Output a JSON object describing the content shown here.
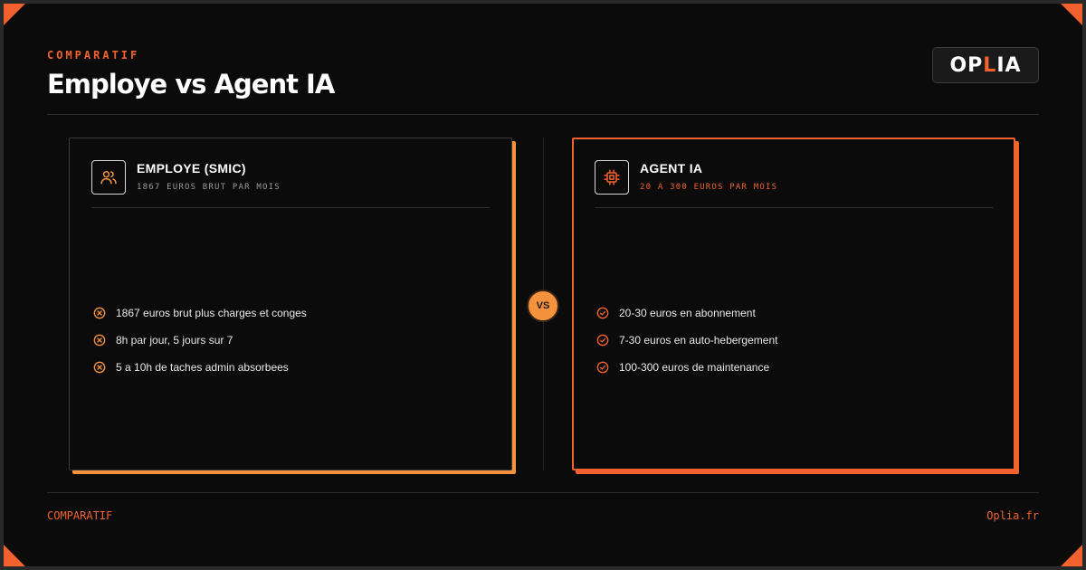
{
  "header": {
    "eyebrow": "COMPARATIF",
    "title": "Employe vs Agent IA"
  },
  "logo": {
    "prefix": "OP",
    "accent": "L",
    "suffix": "IA"
  },
  "vs_label": "VS",
  "cards": {
    "left": {
      "icon": "users-icon",
      "title": "EMPLOYE (SMIC)",
      "subtitle": "1867 EUROS BRUT PAR MOIS",
      "bullet_icon": "x-circle-icon",
      "items": [
        "1867 euros brut plus charges et conges",
        "8h par jour, 5 jours sur 7",
        "5 a 10h de taches admin absorbees"
      ]
    },
    "right": {
      "icon": "cpu-chip-icon",
      "title": "AGENT IA",
      "subtitle": "20 A 300 EUROS PAR MOIS",
      "bullet_icon": "check-circle-icon",
      "items": [
        "20-30 euros en abonnement",
        "7-30 euros en auto-hebergement",
        "100-300 euros de maintenance"
      ]
    }
  },
  "footer": {
    "left": "COMPARATIF",
    "right": "Oplia.fr"
  },
  "colors": {
    "accent": "#f2622e",
    "accent_light": "#f5923e",
    "background": "#0b0b0b"
  }
}
